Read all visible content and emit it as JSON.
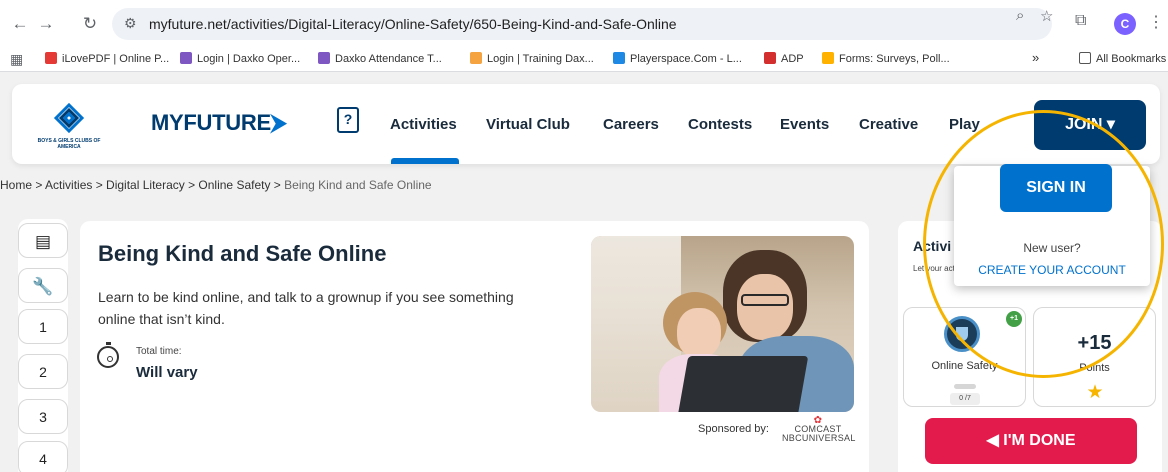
{
  "browser": {
    "url": "myfuture.net/activities/Digital-Literacy/Online-Safety/650-Being-Kind-and-Safe-Online",
    "profile_initial": "C",
    "bookmarks": [
      {
        "label": "iLovePDF | Online P...",
        "color": "#e53935"
      },
      {
        "label": "Login | Daxko Oper...",
        "color": "#7e57c2"
      },
      {
        "label": "Daxko Attendance T...",
        "color": "#7e57c2"
      },
      {
        "label": "Login | Training Dax...",
        "color": "#f4a340"
      },
      {
        "label": "Playerspace.Com - L...",
        "color": "#1e88e5"
      },
      {
        "label": "ADP",
        "color": "#d32f2f"
      },
      {
        "label": "Forms: Surveys, Poll...",
        "color": "#ffb300"
      }
    ],
    "more_bookmarks": "»",
    "all_bookmarks": "All Bookmarks"
  },
  "header": {
    "logo_sub": "BOYS & GIRLS CLUBS OF AMERICA",
    "brand": "MYFUTURE",
    "brand_arrow": "⮞",
    "book_glyph": "?",
    "nav": [
      "Activities",
      "Virtual Club",
      "Careers",
      "Contests",
      "Events",
      "Creative",
      "Play"
    ],
    "join": "JOIN ▾"
  },
  "breadcrumb": {
    "trail": "Home > Activities > Digital Literacy > Online Safety > ",
    "current": "Being Kind and Safe Online"
  },
  "rail": {
    "items": [
      "1",
      "2",
      "3",
      "4"
    ]
  },
  "activity": {
    "title": "Being Kind and Safe Online",
    "description": "Learn to be kind online, and talk to a grownup if you see something online that isn’t kind.",
    "time_label": "Total time:",
    "time_value": "Will vary",
    "sponsor_label": "Sponsored by:",
    "sponsor_line1": "COMCAST",
    "sponsor_line2": "NBCUNIVERSAL"
  },
  "panel": {
    "title": "Activi",
    "subtitle": "Let your activit",
    "badge_name": "Online Safety",
    "badge_plus": "+1",
    "progress": "0 /7",
    "progress_fraction": 0,
    "points_value": "+15",
    "points_label": "Points",
    "done": "I'M DONE"
  },
  "dropdown": {
    "sign_in": "SIGN IN",
    "new_user": "New user?",
    "create": "CREATE YOUR ACCOUNT"
  },
  "colors": {
    "navy": "#003b6f",
    "blue": "#0072ce",
    "done_red": "#e31b4d",
    "highlight": "#f5b400"
  }
}
